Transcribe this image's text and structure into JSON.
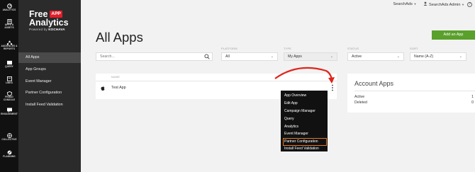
{
  "rail": [
    {
      "label": "Analytics",
      "icon": "analytics-icon"
    },
    {
      "label": "Apps & Assets",
      "icon": "apps-assets-icon"
    },
    {
      "label": "Audiences & Reports",
      "icon": "audiences-reports-icon"
    },
    {
      "label": "Query",
      "icon": "query-icon"
    },
    {
      "label": "Links",
      "icon": "links-icon"
    },
    {
      "label": "Fraud Console",
      "icon": "fraud-console-icon"
    },
    {
      "label": "Engagement",
      "icon": "engagement-icon"
    },
    {
      "label": "Collective",
      "icon": "collective-icon"
    },
    {
      "label": "Planning",
      "icon": "planning-icon"
    }
  ],
  "brand": {
    "line1": "Free",
    "badge": "APP",
    "line2": "Analytics",
    "powered": "Powered by",
    "company": "KOCHAVA",
    "badge_color": "#e11d2a"
  },
  "nav": {
    "items": [
      "All Apps",
      "App Groups",
      "Event Manager",
      "Partner Configuration",
      "Install Feed Validation"
    ],
    "active_index": 0
  },
  "topbar": {
    "workspace": "SearchAds",
    "user": "SearchAds Admin",
    "help": "?"
  },
  "page": {
    "title": "All Apps",
    "add_button": "Add an App",
    "accent": "#5aa02c"
  },
  "filters": {
    "search_placeholder": "Search...",
    "platform": {
      "label": "PLATFORM",
      "value": "All"
    },
    "type": {
      "label": "TYPE",
      "value": "My Apps"
    },
    "status": {
      "label": "STATUS",
      "value": "Active"
    },
    "sort": {
      "label": "SORT",
      "value": "Name (A-Z)"
    }
  },
  "table": {
    "column": "NAME",
    "rows": [
      {
        "name": "Test App",
        "platform_icon": "apple-icon"
      }
    ]
  },
  "menu": {
    "items": [
      "App Overview",
      "Edit App",
      "Campaign Manager",
      "Query",
      "Analytics",
      "Event Manager",
      "Partner Configuration",
      "Install Feed Validation"
    ],
    "highlighted": "Partner Configuration",
    "highlight_color": "#e8761f"
  },
  "account": {
    "title": "Account Apps",
    "rows": [
      {
        "label": "Active",
        "value": "1"
      },
      {
        "label": "Deleted",
        "value": "0"
      }
    ]
  },
  "annotation": {
    "arrow_color": "#e0241b"
  }
}
